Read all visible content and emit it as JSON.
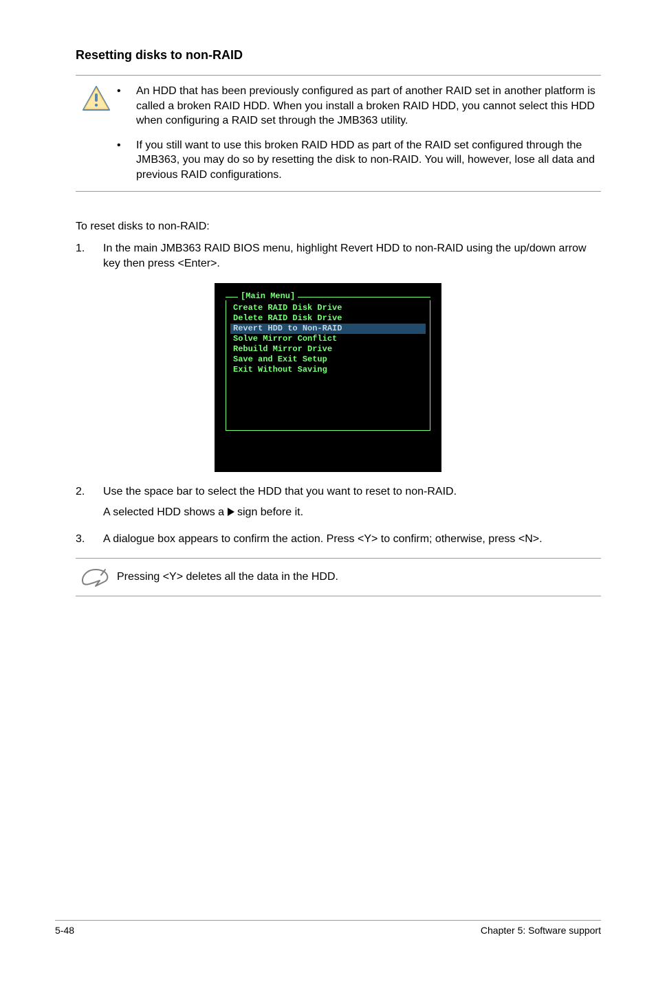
{
  "heading": "Resetting disks to non-RAID",
  "caution": {
    "items": [
      "An HDD that has been previously configured as part of another RAID set in another platform is called a broken RAID HDD. When you install a broken RAID HDD, you cannot select this HDD when configuring a RAID set through the JMB363 utility.",
      "If you still want to use this broken RAID HDD as part of the RAID set configured through the JMB363, you may do so by resetting the disk to non-RAID. You will, however, lose all data and previous RAID configurations."
    ]
  },
  "intro": "To reset disks to non-RAID:",
  "steps": {
    "s1": {
      "num": "1.",
      "text": "In the main JMB363 RAID BIOS menu, highlight Revert HDD to non-RAID using the up/down arrow key then press <Enter>."
    },
    "s2": {
      "num": "2.",
      "line1": "Use the space bar to select the HDD that you want to reset to non-RAID.",
      "line2a": "A selected HDD shows a ",
      "line2b": " sign before it."
    },
    "s3": {
      "num": "3.",
      "text": "A dialogue box appears to confirm the action. Press <Y> to confirm; otherwise, press <N>."
    }
  },
  "bios": {
    "title": "[Main Menu]",
    "items": [
      {
        "label": "Create RAID Disk Drive",
        "hl": false
      },
      {
        "label": "Delete RAID Disk Drive",
        "hl": false
      },
      {
        "label": "Revert HDD to Non-RAID",
        "hl": true
      },
      {
        "label": "Solve Mirror Conflict",
        "hl": false
      },
      {
        "label": "Rebuild Mirror Drive",
        "hl": false
      },
      {
        "label": "Save and Exit Setup",
        "hl": false
      },
      {
        "label": "Exit Without Saving",
        "hl": false
      }
    ]
  },
  "note": "Pressing <Y> deletes all the data in the HDD.",
  "footer": {
    "left": "5-48",
    "right": "Chapter 5: Software support"
  }
}
